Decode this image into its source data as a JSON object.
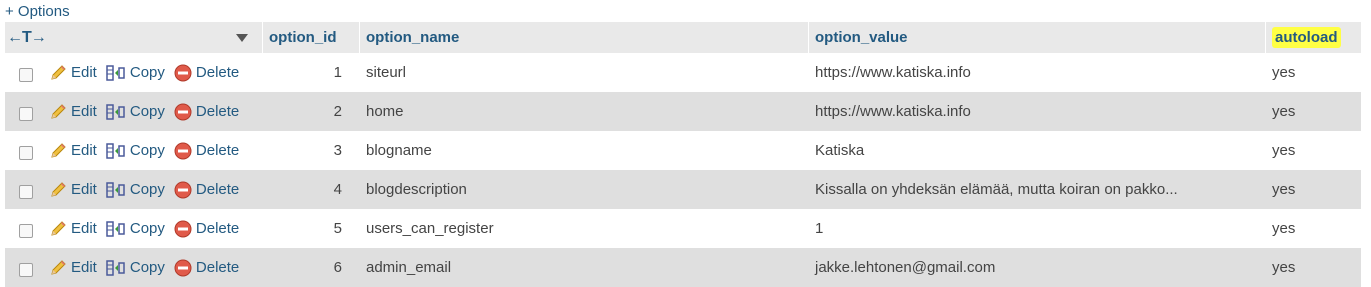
{
  "options_link": "+ Options",
  "header": {
    "columns": [
      "option_id",
      "option_name",
      "option_value",
      "autoload"
    ]
  },
  "action_labels": {
    "edit": "Edit",
    "copy": "Copy",
    "delete": "Delete"
  },
  "rows": [
    {
      "id": "1",
      "name": "siteurl",
      "value": "https://www.katiska.info",
      "autoload": "yes"
    },
    {
      "id": "2",
      "name": "home",
      "value": "https://www.katiska.info",
      "autoload": "yes"
    },
    {
      "id": "3",
      "name": "blogname",
      "value": "Katiska",
      "autoload": "yes"
    },
    {
      "id": "4",
      "name": "blogdescription",
      "value": "Kissalla on yhdeksän elämää, mutta koiran on pakko...",
      "autoload": "yes"
    },
    {
      "id": "5",
      "name": "users_can_register",
      "value": "1",
      "autoload": "yes"
    },
    {
      "id": "6",
      "name": "admin_email",
      "value": "jakke.lehtonen@gmail.com",
      "autoload": "yes"
    }
  ],
  "colors": {
    "link": "#235a81",
    "row_alt": "#dfdfdf",
    "header_bg": "#e9e9e9",
    "highlight": "#ffff44"
  }
}
